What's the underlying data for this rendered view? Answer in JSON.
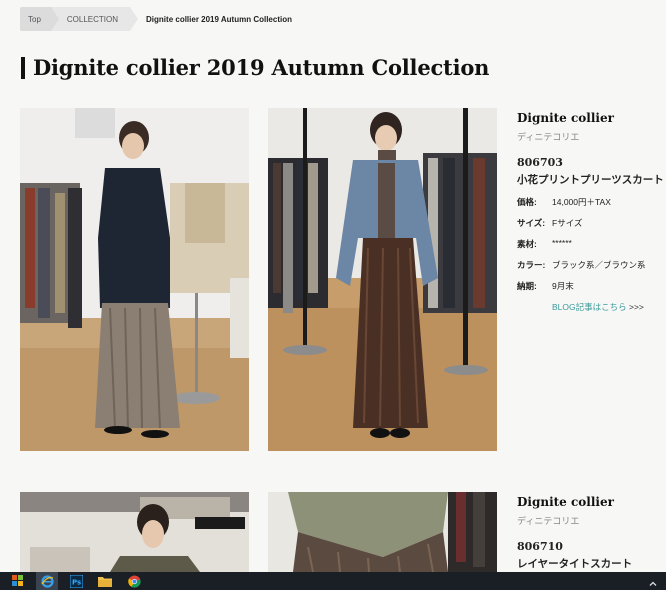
{
  "breadcrumb": {
    "top": "Top",
    "collection": "COLLECTION",
    "current": "Dignite collier 2019 Autumn Collection"
  },
  "page_title": "Dignite collier 2019 Autumn Collection",
  "products": [
    {
      "brand": "Dignite collier",
      "brand_kana": "ディニテコリエ",
      "code": "806703",
      "name": "小花プリントプリーツスカート",
      "specs": [
        {
          "label": "価格:",
          "value": "14,000円＋TAX"
        },
        {
          "label": "サイズ:",
          "value": "Fサイズ"
        },
        {
          "label": "素材:",
          "value": "******"
        },
        {
          "label": "カラー:",
          "value": "ブラック系／ブラウン系"
        },
        {
          "label": "納期:",
          "value": "9月末"
        }
      ],
      "blog_link": "BLOG記事はこちら",
      "blog_arrows": ">>>"
    },
    {
      "brand": "Dignite collier",
      "brand_kana": "ディニテコリエ",
      "code": "806710",
      "name": "レイヤータイトスカート"
    }
  ],
  "taskbar": {
    "icons": [
      "windows-explorer-icon",
      "internet-explorer-icon",
      "photoshop-icon",
      "folder-icon",
      "chrome-icon"
    ]
  },
  "colors": {
    "link": "#3a9a9a",
    "background": "#f7f7f6",
    "taskbar": "#1a1f26"
  }
}
